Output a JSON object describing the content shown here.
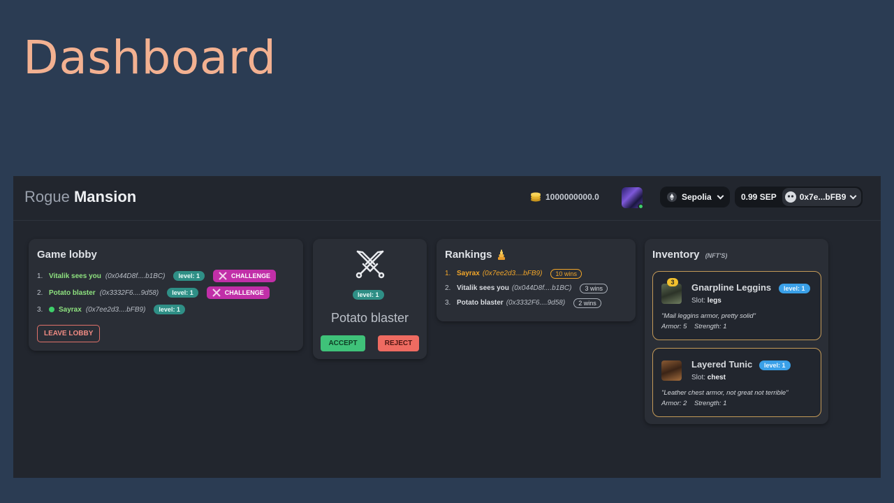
{
  "slide": {
    "title": "Dashboard"
  },
  "header": {
    "brand_light": "Rogue",
    "brand_bold": "Mansion",
    "coins": "1000000000.0",
    "network": "Sepolia",
    "balance": "0.99 SEP",
    "address": "0x7e...bFB9"
  },
  "lobby": {
    "title": "Game lobby",
    "players": [
      {
        "num": "1.",
        "name": "Vitalik sees you",
        "addr": "(0x044D8f....b1BC)",
        "level": "level: 1",
        "action": "CHALLENGE"
      },
      {
        "num": "2.",
        "name": "Potato blaster",
        "addr": "(0x3332F6....9d58)",
        "level": "level: 1",
        "action": "CHALLENGE"
      },
      {
        "num": "3.",
        "name": "Sayrax",
        "addr": "(0x7ee2d3....bFB9)",
        "level": "level: 1"
      }
    ],
    "leave_label": "LEAVE LOBBY"
  },
  "duel": {
    "level": "level: 1",
    "opponent": "Potato blaster",
    "accept_label": "ACCEPT",
    "reject_label": "REJECT"
  },
  "rankings": {
    "title": "Rankings",
    "rows": [
      {
        "num": "1.",
        "name": "Sayrax",
        "addr": "(0x7ee2d3....bFB9)",
        "wins": "10 wins"
      },
      {
        "num": "2.",
        "name": "Vitalik sees you",
        "addr": "(0x044D8f....b1BC)",
        "wins": "3 wins"
      },
      {
        "num": "3.",
        "name": "Potato blaster",
        "addr": "(0x3332F6....9d58)",
        "wins": "2 wins"
      }
    ]
  },
  "inventory": {
    "title": "Inventory",
    "subtitle": "(NFT'S)",
    "items": [
      {
        "count": "3",
        "name": "Gnarpline Leggins",
        "level": "level: 1",
        "slot_label": "Slot:",
        "slot": "legs",
        "desc": "\"Mail leggins armor, pretty solid\"",
        "armor": "Armor: 5",
        "strength": "Strength: 1"
      },
      {
        "name": "Layered Tunic",
        "level": "level: 1",
        "slot_label": "Slot:",
        "slot": "chest",
        "desc": "\"Leather chest armor, not great not terrible\"",
        "armor": "Armor: 2",
        "strength": "Strength: 1"
      }
    ]
  }
}
